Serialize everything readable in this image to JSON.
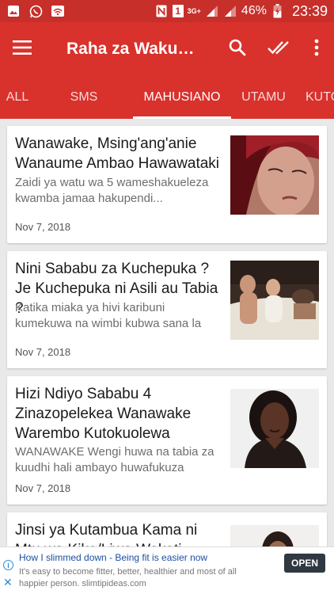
{
  "status_bar": {
    "network_type": "3G+",
    "sim_number": "1",
    "battery": "46%",
    "time": "23:39"
  },
  "app_bar": {
    "title": "Raha za Wakubwa"
  },
  "tabs": [
    {
      "label": "ALL",
      "active": false
    },
    {
      "label": "SMS",
      "active": false
    },
    {
      "label": "MAHUSIANO",
      "active": true
    },
    {
      "label": "UTAMU",
      "active": false
    },
    {
      "label": "KUTONGOZA",
      "active": false
    }
  ],
  "articles": [
    {
      "title": "Wanawake, Msing'ang'anie Wanaume Ambao Hawawataki",
      "excerpt": "Zaidi ya watu wa 5 wameshakueleza kwamba jamaa hakupendi...",
      "date": "Nov 7, 2018",
      "thumb_icon": "woman-crying-photo"
    },
    {
      "title": "Nini Sababu za Kuchepuka ? Je Kuchepuka ni Asili au Tabia ?",
      "excerpt": "Katika miaka ya hivi karibuni kumekuwa na wimbi kubwa sana la kuchepuka...",
      "date": "Nov 7, 2018",
      "thumb_icon": "couple-in-bed-photo"
    },
    {
      "title": "Hizi Ndiyo Sababu 4 Zinazopelekea Wanawake Warembo Kutokuolewa",
      "excerpt": "WANAWAKE Wengi huwa na tabia za kuudhi hali ambayo huwafukuza wanaume...",
      "date": "Nov 7, 2018",
      "thumb_icon": "woman-portrait-photo"
    },
    {
      "title": "Jinsi ya Kutambua Kama ni Mtu wa Kike/Liwa Wakati",
      "excerpt": "",
      "date": "",
      "thumb_icon": "woman-photo"
    }
  ],
  "ad": {
    "title": "How I slimmed down - Being fit is easier now",
    "body": "It's easy to become fitter, better, healthier and most of all happier person. slimtipideas.com",
    "button": "OPEN",
    "accent": "#1a4fa3"
  },
  "colors": {
    "status_bar": "#c62f2a",
    "app_bar": "#d9312c",
    "background": "#e9e9e9"
  }
}
